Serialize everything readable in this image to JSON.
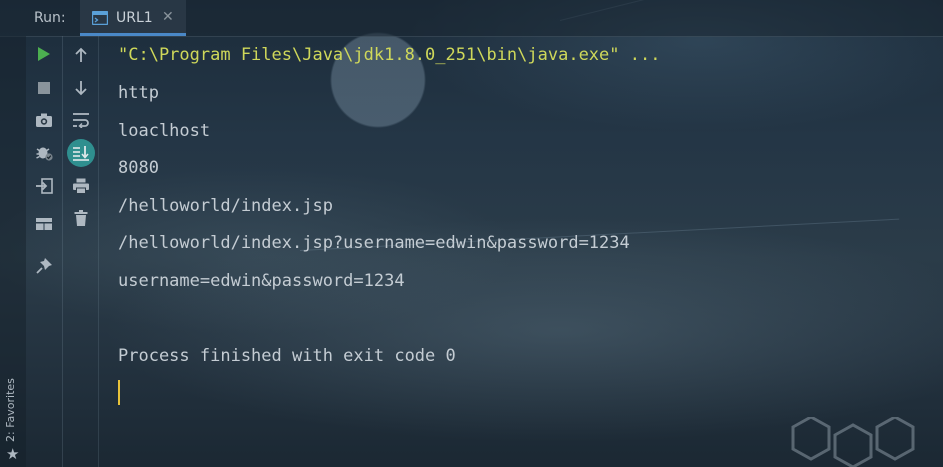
{
  "header": {
    "run_label": "Run:",
    "tab": {
      "label": "URL1",
      "icon": "console-window-icon",
      "close_icon": "close-icon"
    }
  },
  "left_toolbar": [
    {
      "name": "rerun-icon",
      "color": "#4caf50"
    },
    {
      "name": "stop-icon"
    },
    {
      "name": "camera-icon"
    },
    {
      "name": "debug-bug-icon"
    },
    {
      "name": "exit-icon"
    },
    {
      "name": "layout-icon"
    },
    {
      "name": "pin-icon"
    }
  ],
  "right_toolbar": [
    {
      "name": "up-arrow-icon"
    },
    {
      "name": "down-arrow-icon"
    },
    {
      "name": "soft-wrap-icon"
    },
    {
      "name": "scroll-to-end-icon",
      "active": true,
      "color": "#2f8f8f"
    },
    {
      "name": "print-icon"
    },
    {
      "name": "trash-icon"
    }
  ],
  "favorites": {
    "label": "2: Favorites",
    "icon": "star-icon"
  },
  "console": {
    "command": "\"C:\\Program Files\\Java\\jdk1.8.0_251\\bin\\java.exe\" ...",
    "lines": [
      "http",
      "loaclhost",
      "8080",
      "/helloworld/index.jsp",
      "/helloworld/index.jsp?username=edwin&password=1234",
      "username=edwin&password=1234"
    ],
    "finish": "Process finished with exit code 0"
  },
  "colors": {
    "command": "#cfd85a",
    "text": "#c4ccd3",
    "caret": "#e8c33a",
    "tab_underline": "#4a88c7"
  }
}
